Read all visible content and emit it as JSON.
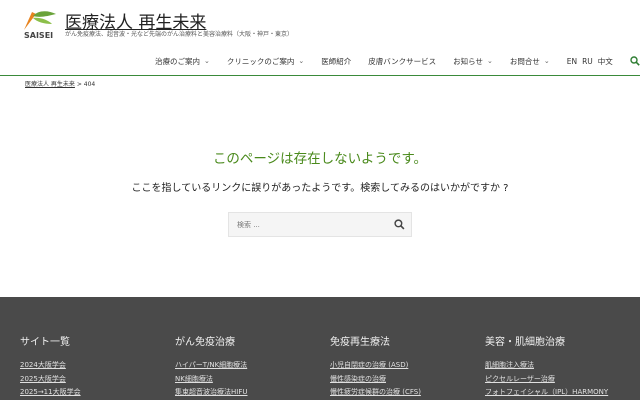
{
  "header": {
    "logo_text": "SAISEI",
    "site_title": "医療法人 再生未来",
    "tagline": "がん免疫療法、超音波・光など先端のがん治療料と美容治療料（大阪・神戸・東京）"
  },
  "nav": {
    "items": [
      {
        "label": "治療のご案内",
        "dropdown": true
      },
      {
        "label": "クリニックのご案内",
        "dropdown": true
      },
      {
        "label": "医師紹介",
        "dropdown": false
      },
      {
        "label": "皮膚バンクサービス",
        "dropdown": false
      },
      {
        "label": "お知らせ",
        "dropdown": true
      },
      {
        "label": "お問合せ",
        "dropdown": true
      }
    ],
    "languages": [
      "EN",
      "RU",
      "中文"
    ],
    "search_icon": "search-icon"
  },
  "breadcrumb": {
    "home": "医療法人 再生未来",
    "separator": ">",
    "current": "404"
  },
  "error": {
    "title": "このページは存在しないようです。",
    "message": "ここを指しているリンクに誤りがあったようです。検索してみるのはいかがですか ?"
  },
  "search": {
    "placeholder": "検索 ...",
    "value": ""
  },
  "footer": {
    "columns": [
      {
        "heading": "サイト一覧",
        "links": [
          "2024大阪学会",
          "2025大阪学会",
          "2025→11大阪学会"
        ]
      },
      {
        "heading": "がん免疫治療",
        "links": [
          "ハイパーT/NK細胞療法",
          "NK細胞療法",
          "集束超音波治療法HIFU"
        ]
      },
      {
        "heading": "免疫再生療法",
        "links": [
          "小児自閉症の治療 (ASD)",
          "慢性感染症の治療",
          "慢性疲労症候群の治療 (CFS)"
        ]
      },
      {
        "heading": "美容・肌細胞治療",
        "links": [
          "肌細胞注入療法",
          "ピクセルレーザー治療",
          "フォトフェイシャル（IPL）HARMONY"
        ]
      }
    ]
  },
  "colors": {
    "accent_green": "#4a8a1c",
    "header_line": "#3a8a3a",
    "footer_bg": "#4a4a4a",
    "logo_orange": "#e8841f"
  }
}
